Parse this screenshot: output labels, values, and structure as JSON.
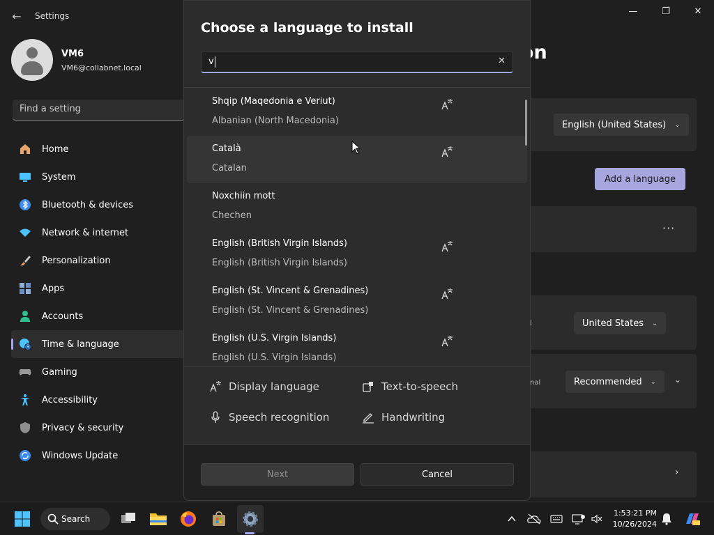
{
  "window": {
    "app_title": "Settings",
    "back_glyph": "←",
    "controls": {
      "minimize": "—",
      "maximize": "❐",
      "close": "✕"
    }
  },
  "profile": {
    "name": "VM6",
    "email": "VM6@collabnet.local"
  },
  "search_settings": {
    "placeholder": "Find a setting"
  },
  "nav": {
    "items": [
      {
        "label": "Home",
        "icon": "home-icon",
        "color": "#e8a46b"
      },
      {
        "label": "System",
        "icon": "monitor-icon",
        "color": "#4cc2ff"
      },
      {
        "label": "Bluetooth & devices",
        "icon": "bluetooth-icon",
        "color": "#3b8cf0"
      },
      {
        "label": "Network & internet",
        "icon": "wifi-icon",
        "color": "#4cc2ff"
      },
      {
        "label": "Personalization",
        "icon": "brush-icon",
        "color": "#e8a46b"
      },
      {
        "label": "Apps",
        "icon": "apps-icon",
        "color": "#8fb0d9"
      },
      {
        "label": "Accounts",
        "icon": "person-icon",
        "color": "#2fbf8f"
      },
      {
        "label": "Time & language",
        "icon": "globe-clock-icon",
        "color": "#4cc2ff",
        "active": true
      },
      {
        "label": "Gaming",
        "icon": "gamepad-icon",
        "color": "#9a9a9a"
      },
      {
        "label": "Accessibility",
        "icon": "accessibility-icon",
        "color": "#4cc2ff"
      },
      {
        "label": "Privacy & security",
        "icon": "shield-icon",
        "color": "#8f8f8f"
      },
      {
        "label": "Windows Update",
        "icon": "update-icon",
        "color": "#3b8cf0"
      }
    ]
  },
  "background": {
    "heading_partial": "egion",
    "windows_display_language": "English (United States)",
    "add_language_label": "Add a language",
    "more_label": "···",
    "region_partial_label": "l",
    "country": "United States",
    "format_partial_label": "nal",
    "regional_format": "Recommended",
    "chevron_down": "⌄",
    "chevron_right": "›"
  },
  "dialog": {
    "title": "Choose a language to install",
    "search_value": "v",
    "clear_glyph": "✕",
    "languages": [
      {
        "native": "Shqip (Maqedonia e Veriut)",
        "english": "Albanian (North Macedonia)",
        "display_language": true
      },
      {
        "native": "Català",
        "english": "Catalan",
        "display_language": true,
        "hover": true
      },
      {
        "native": "Noxchiin mott",
        "english": "Chechen",
        "display_language": false
      },
      {
        "native": "English (British Virgin Islands)",
        "english": "English (British Virgin Islands)",
        "display_language": true
      },
      {
        "native": "English (St. Vincent & Grenadines)",
        "english": "English (St. Vincent & Grenadines)",
        "display_language": true
      },
      {
        "native": "English (U.S. Virgin Islands)",
        "english": "English (U.S. Virgin Islands)",
        "display_language": true
      }
    ],
    "legend": {
      "display_language": "Display language",
      "text_to_speech": "Text-to-speech",
      "speech_recognition": "Speech recognition",
      "handwriting": "Handwriting"
    },
    "next_label": "Next",
    "cancel_label": "Cancel"
  },
  "taskbar": {
    "search_label": "Search",
    "time": "1:53:21 PM",
    "date": "10/26/2024",
    "tray_chevron": "^"
  },
  "colors": {
    "accent": "#a5a5f0",
    "add_button": "#a8a6de",
    "dialog_bg": "#2c2c2c",
    "window_bg": "#1f1f1f"
  }
}
